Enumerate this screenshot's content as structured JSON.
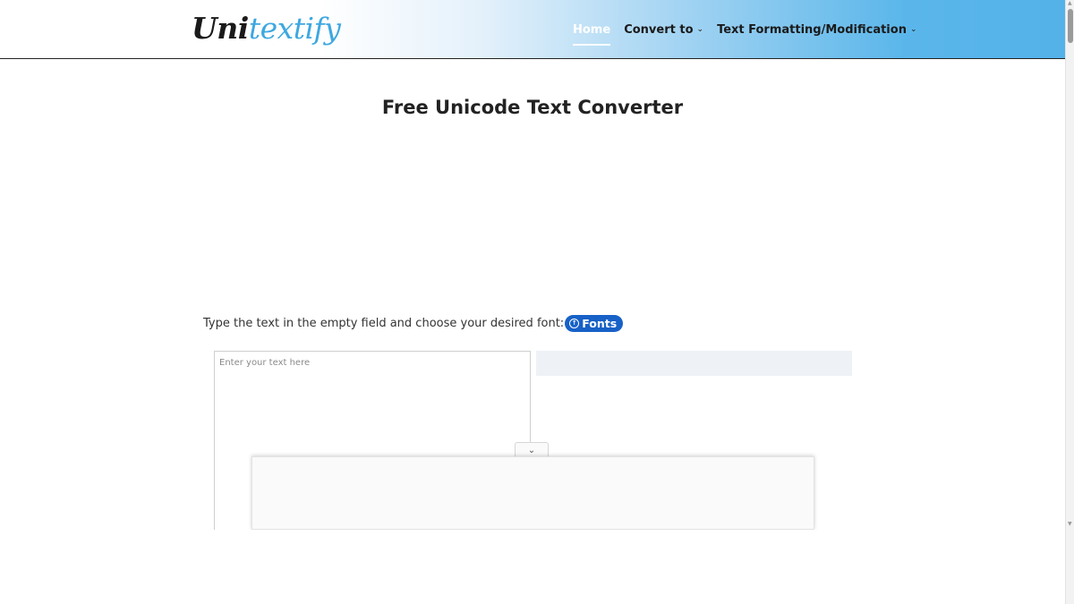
{
  "header": {
    "logo_part1": "Uni",
    "logo_part2": "textify",
    "nav": {
      "home": "Home",
      "convert_to": "Convert to",
      "text_formatting": "Text Formatting/Modification"
    }
  },
  "main": {
    "title": "Free Unicode Text Converter",
    "instruction": "Type the text in the empty field and choose your desired font:",
    "fonts_button": "Fonts",
    "input_placeholder": "Enter your text here",
    "input_value": ""
  },
  "icons": {
    "nav_dropdown": "chevron-down-icon",
    "fonts_button": "arrow-circle-icon",
    "ad_toggle": "chevron-down-icon"
  },
  "colors": {
    "header_gradient_end": "#54b2e9",
    "fonts_button_bg": "#1761c7",
    "logo_accent": "#3ea8e0"
  }
}
